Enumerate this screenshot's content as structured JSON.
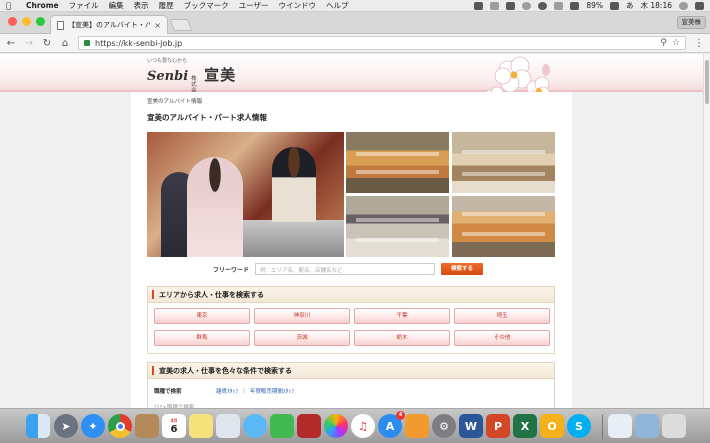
{
  "menubar": {
    "app": "Chrome",
    "items": [
      "ファイル",
      "編集",
      "表示",
      "履歴",
      "ブックマーク",
      "ユーザー",
      "ウインドウ",
      "ヘルプ"
    ],
    "battery": "89%",
    "ime": "あ",
    "clock": "木 18:16",
    "icons": [
      "dropbox-icon",
      "google-drive-icon",
      "adobe-icon",
      "time-machine-icon",
      "bluetooth-icon",
      "wifi-icon",
      "volume-icon",
      "battery-icon",
      "search-icon",
      "list-icon"
    ]
  },
  "browser": {
    "tab_title": "【宣美】のアルバイト・パート求人",
    "tab_close": "×",
    "profile": "宣美株",
    "url": "https://kk-senbi-job.jp"
  },
  "site": {
    "logo_tagline": "いつも豊な心から",
    "logo_en": "Senbi",
    "logo_kk": "株式会社",
    "logo_jp": "宣美",
    "breadcrumb": "宣美のアルバイト情報",
    "page_title": "宣美のアルバイト・パート求人情報",
    "search": {
      "label": "フリーワード",
      "placeholder": "例：エリア名、駅名、店舗名など",
      "button": "検索する"
    },
    "area_panel": {
      "title": "エリアから求人・仕事を検索する",
      "areas": [
        "東京",
        "神奈川",
        "千葉",
        "埼玉",
        "群馬",
        "茨城",
        "栃木",
        "その他"
      ]
    },
    "cond_panel": {
      "title": "宣美の求人・仕事を色々な条件で検索する",
      "row_label": "職種で検索",
      "links": [
        "雑貨ｽﾀｯﾌ",
        "年賀販売期間ｽﾀｯﾌ"
      ],
      "row2_label": "ｴﾘｱ×職種で検索"
    }
  },
  "dock": {
    "apps": [
      "finder",
      "launchpad",
      "safari",
      "chrome",
      "contacts",
      "calendar",
      "notes",
      "preview",
      "messages",
      "facetime",
      "photo-booth",
      "photos",
      "itunes",
      "app-store",
      "ibooks",
      "system-preferences",
      "word",
      "powerpoint",
      "excel",
      "outlook",
      "skype",
      "documents",
      "folder",
      "trash"
    ],
    "calendar_day": "6",
    "calendar_month": "4月",
    "app_store_badge": "4"
  },
  "colors": {
    "accent": "#d84a1b",
    "area_text": "#c0392b",
    "link": "#2a5db0",
    "search_button": "#e45a1c"
  }
}
